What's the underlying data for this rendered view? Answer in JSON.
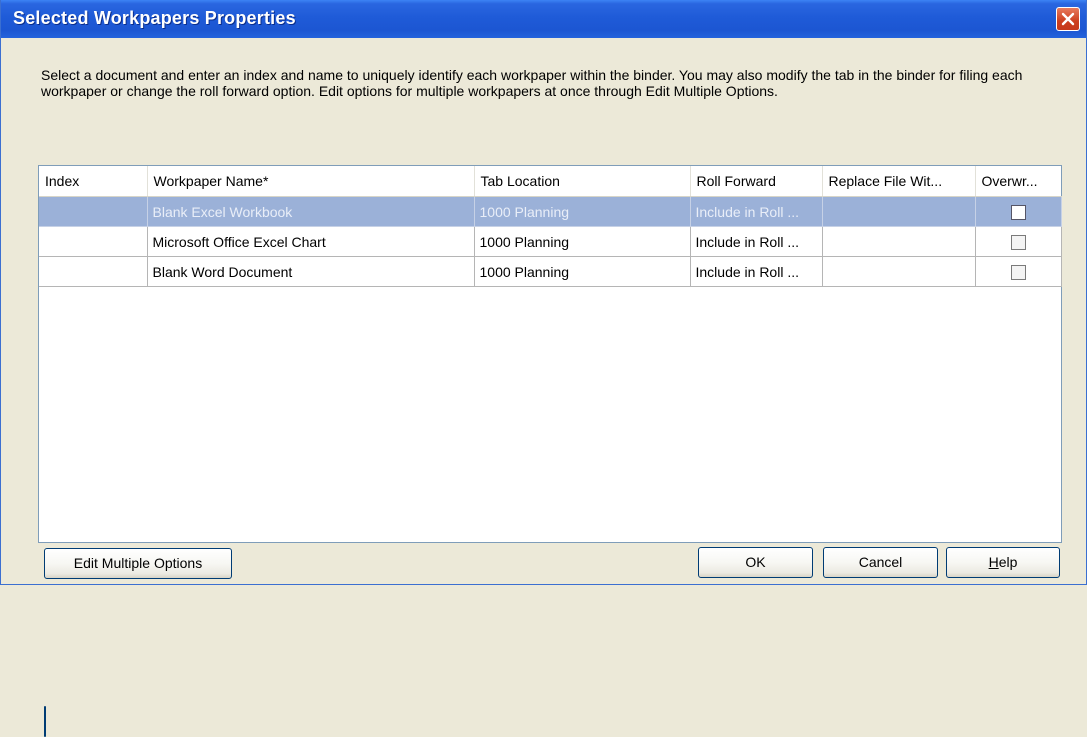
{
  "window": {
    "title": "Selected Workpapers Properties"
  },
  "description": "Select a document and enter an index and name to uniquely identify each workpaper within the binder.  You may also modify the tab in the binder for filing each workpaper or change the roll forward option. Edit options for multiple workpapers at once through Edit Multiple Options.",
  "grid": {
    "columns": [
      "Index",
      "Workpaper Name*",
      "Tab Location",
      "Roll Forward",
      "Replace File Wit...",
      "Overwr..."
    ],
    "rows": [
      {
        "index": "",
        "name": "Blank Excel Workbook",
        "tab": "1000 Planning",
        "roll": "Include in Roll ...",
        "replace": "",
        "overwrite": false,
        "selected": true
      },
      {
        "index": "",
        "name": "Microsoft Office Excel Chart",
        "tab": "1000 Planning",
        "roll": "Include in Roll ...",
        "replace": "",
        "overwrite": false,
        "selected": false
      },
      {
        "index": "",
        "name": "Blank Word Document",
        "tab": "1000 Planning",
        "roll": "Include in Roll ...",
        "replace": "",
        "overwrite": false,
        "selected": false
      }
    ]
  },
  "buttons": {
    "edit_multiple": "Edit Multiple Options",
    "ok": "OK",
    "cancel": "Cancel",
    "help_mnemonic": "H",
    "help_rest": "elp"
  },
  "colors": {
    "titlebar": "#1f5bd8",
    "selection": "#9bb1d8",
    "dialog_bg": "#ece9d8",
    "close": "#cc3f1f"
  }
}
